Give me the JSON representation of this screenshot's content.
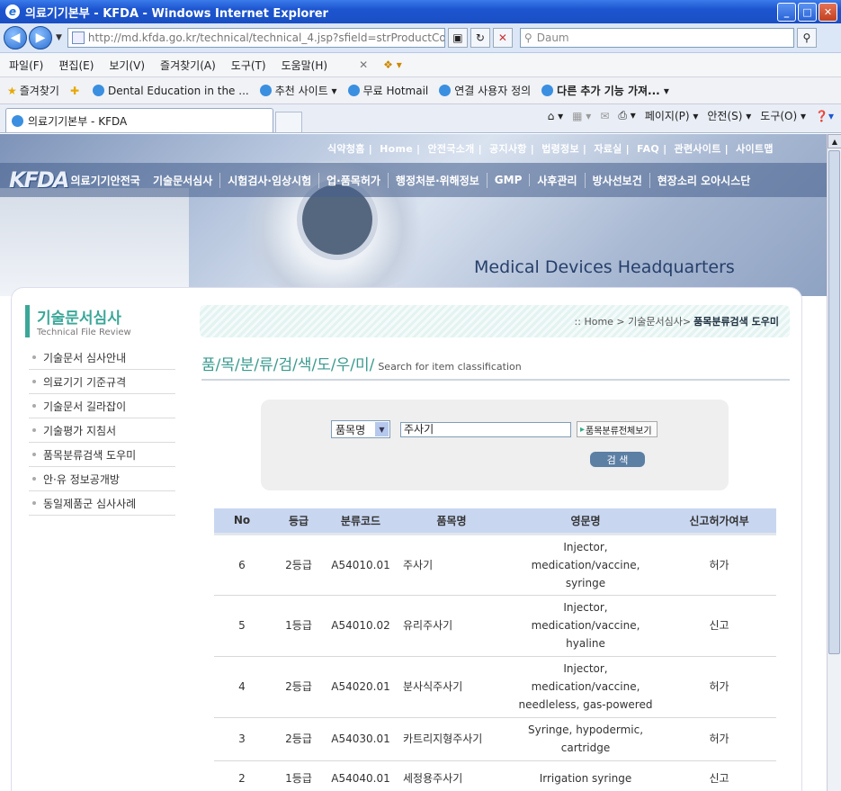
{
  "window": {
    "title": "의료기기본부 - KFDA - Windows Internet Explorer",
    "min": "_",
    "max": "□",
    "close": "✕"
  },
  "address": {
    "url": "http://md.kfda.go.kr/technical/technical_4.jsp?sfield=strProductCo",
    "search_placeholder": "Daum"
  },
  "menu": [
    "파일(F)",
    "편집(E)",
    "보기(V)",
    "즐겨찾기(A)",
    "도구(T)",
    "도움말(H)"
  ],
  "favorites": {
    "label": "즐겨찾기",
    "items": [
      "Dental Education in the ...",
      "추천 사이트 ▾",
      "무료 Hotmail",
      "연결 사용자 정의",
      "다른 추가 기능 가져... ▾"
    ]
  },
  "tab": {
    "title": "의료기기본부 - KFDA"
  },
  "commands": [
    "페이지(P) ▾",
    "안전(S) ▾",
    "도구(O) ▾"
  ],
  "site": {
    "toplinks": [
      "식약청홈",
      "Home",
      "안전국소개",
      "공지사항",
      "법령정보",
      "자료실",
      "FAQ",
      "관련사이트",
      "사이트맵"
    ],
    "logo_text": "KFDA",
    "logo_sub": "의료기기안전국",
    "nav": [
      "기술문서심사",
      "시험검사·임상시험",
      "업·품목허가",
      "행정처분·위해정보",
      "GMP",
      "사후관리",
      "방사선보건",
      "현장소리 오아시스단"
    ],
    "banner_title": "Medical Devices Headquarters"
  },
  "sidebar": {
    "title": "기술문서심사",
    "subtitle": "Technical File Review",
    "items": [
      "기술문서 심사안내",
      "의료기기 기준규격",
      "기술문서 길라잡이",
      "기술평가 지침서",
      "품목분류검색 도우미",
      "안·유 정보공개방",
      "동일제품군 심사사례"
    ]
  },
  "breadcrumb": {
    "prefix": ":: Home > 기술문서심사>",
    "current": "품목분류검색 도우미"
  },
  "page": {
    "title": "품/목/분/류/검/색/도/우/미/",
    "subtitle": "Search for item classification"
  },
  "search": {
    "field": "품목명",
    "keyword": "주사기",
    "view_all": "품목분류전체보기",
    "button": "검 색"
  },
  "table": {
    "headers": [
      "No",
      "등급",
      "분류코드",
      "품목명",
      "영문명",
      "신고허가여부"
    ],
    "rows": [
      {
        "no": "6",
        "grade": "2등급",
        "code": "A54010.01",
        "name": "주사기",
        "en": [
          "Injector,",
          "medication/vaccine,",
          "syringe"
        ],
        "status": "허가"
      },
      {
        "no": "5",
        "grade": "1등급",
        "code": "A54010.02",
        "name": "유리주사기",
        "en": [
          "Injector,",
          "medication/vaccine,",
          "hyaline"
        ],
        "status": "신고"
      },
      {
        "no": "4",
        "grade": "2등급",
        "code": "A54020.01",
        "name": "분사식주사기",
        "en": [
          "Injector,",
          "medication/vaccine,",
          "needleless, gas-powered"
        ],
        "status": "허가"
      },
      {
        "no": "3",
        "grade": "2등급",
        "code": "A54030.01",
        "name": "카트리지형주사기",
        "en": [
          "Syringe, hypodermic,",
          "cartridge"
        ],
        "status": "허가"
      },
      {
        "no": "2",
        "grade": "1등급",
        "code": "A54040.01",
        "name": "세정용주사기",
        "en": [
          "Irrigation syringe"
        ],
        "status": "신고"
      }
    ]
  }
}
